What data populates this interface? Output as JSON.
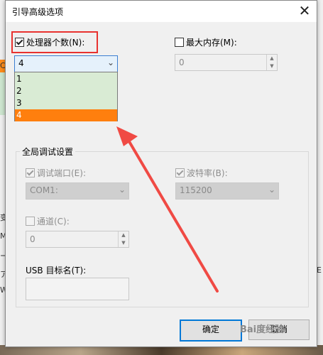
{
  "dialog": {
    "title": "引导高级选项",
    "close_glyph": "✕",
    "processor_count": {
      "label": "处理器个数(N):",
      "checked": true,
      "selected_value": "4",
      "options": [
        "1",
        "2",
        "3",
        "4"
      ],
      "selected_index": 3
    },
    "max_memory": {
      "label": "最大内存(M):",
      "checked": false,
      "value": "0"
    },
    "global_debug": {
      "title": "全局调试设置",
      "debug_port": {
        "label": "调试端口(E):",
        "checked": true,
        "value": "COM1:"
      },
      "baud_rate": {
        "label": "波特率(B):",
        "checked": true,
        "value": "115200"
      },
      "channel": {
        "label": "通道(C):",
        "checked": false,
        "value": "0"
      },
      "usb_target": {
        "label": "USB 目标名(T):",
        "value": ""
      }
    },
    "buttons": {
      "ok": "确定",
      "cancel": "取消"
    }
  },
  "background": {
    "fragments": [
      "CO",
      "变",
      "M",
      "ー",
      "ア",
      "E",
      "W"
    ]
  },
  "overlay": {
    "watermark": "Bai度经验",
    "colors": {
      "highlight": "#e8322f",
      "arrow": "#f04a44",
      "selected_option": "#ff7f0e",
      "dropdown_bg": "#d9ebd4"
    }
  }
}
